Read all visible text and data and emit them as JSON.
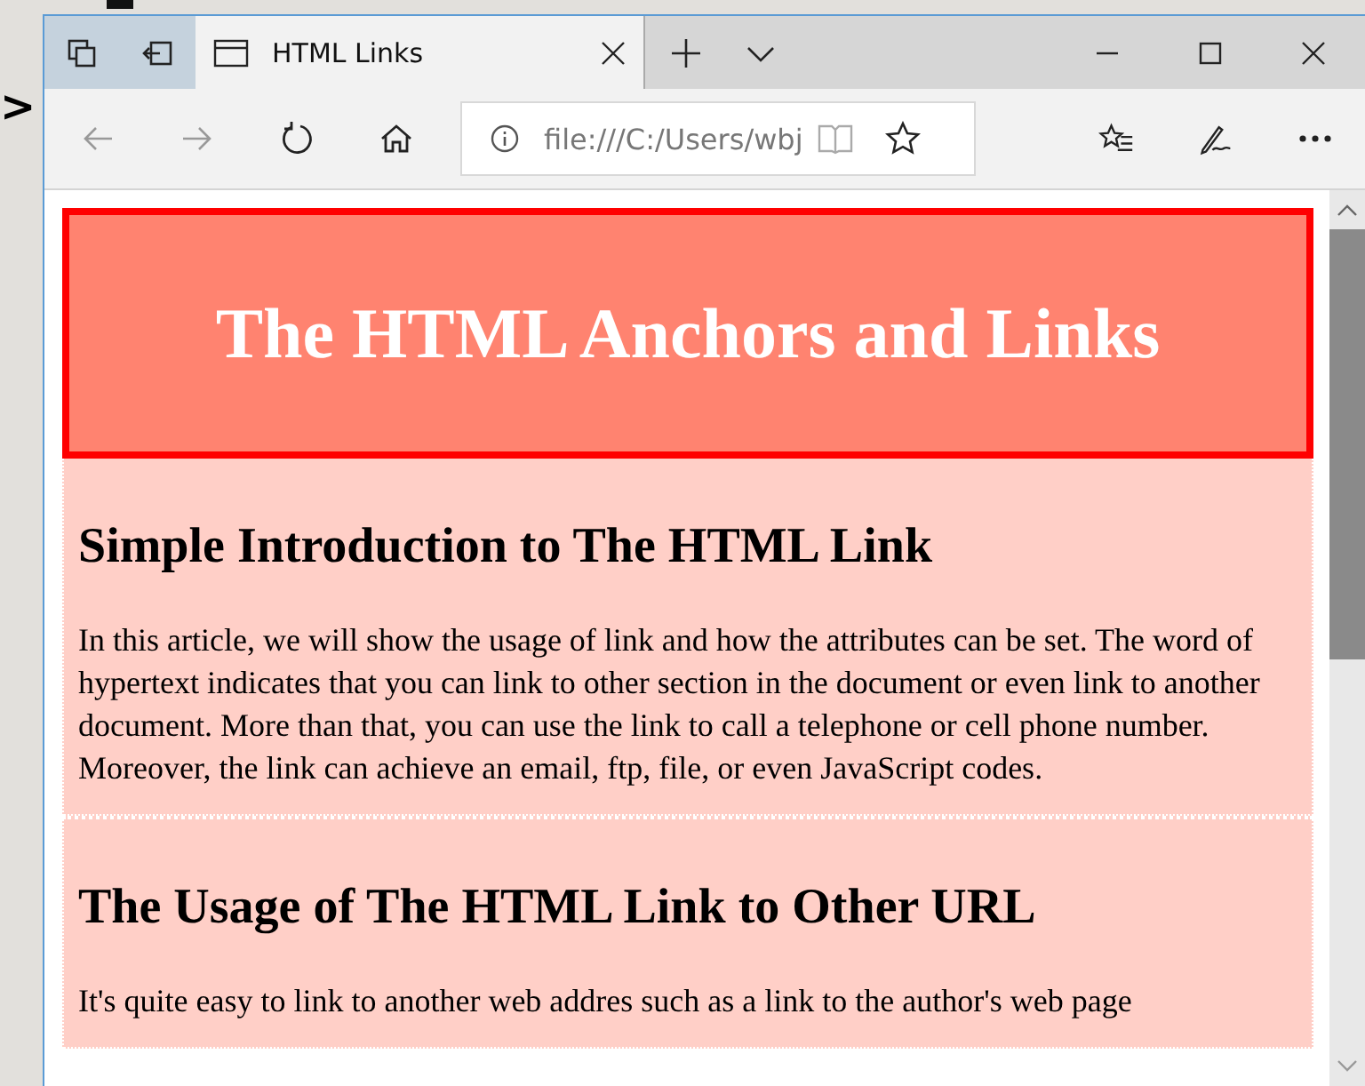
{
  "backdrop": {
    "text": ">"
  },
  "tabs": [
    {
      "title": "HTML Links",
      "selected": true
    }
  ],
  "navigation": {
    "back_disabled": true,
    "forward_disabled": true
  },
  "address_bar": {
    "url": "file:///C:/Users/wbj"
  },
  "page": {
    "title": "The HTML Anchors and Links",
    "sections": [
      {
        "heading": "Simple Introduction to The HTML Link",
        "paragraph": "In this article, we will show the usage of link and how the attributes can be set. The word of hypertext indicates that you can link to other section in the document or even link to another document. More than that, you can use the link to call a telephone or cell phone number. Moreover, the link can achieve an email, ftp, file, or even JavaScript codes."
      },
      {
        "heading": "The Usage of The HTML Link to Other URL",
        "paragraph": "It's quite easy to link to another web addres such as a link to the author's web page"
      }
    ]
  }
}
